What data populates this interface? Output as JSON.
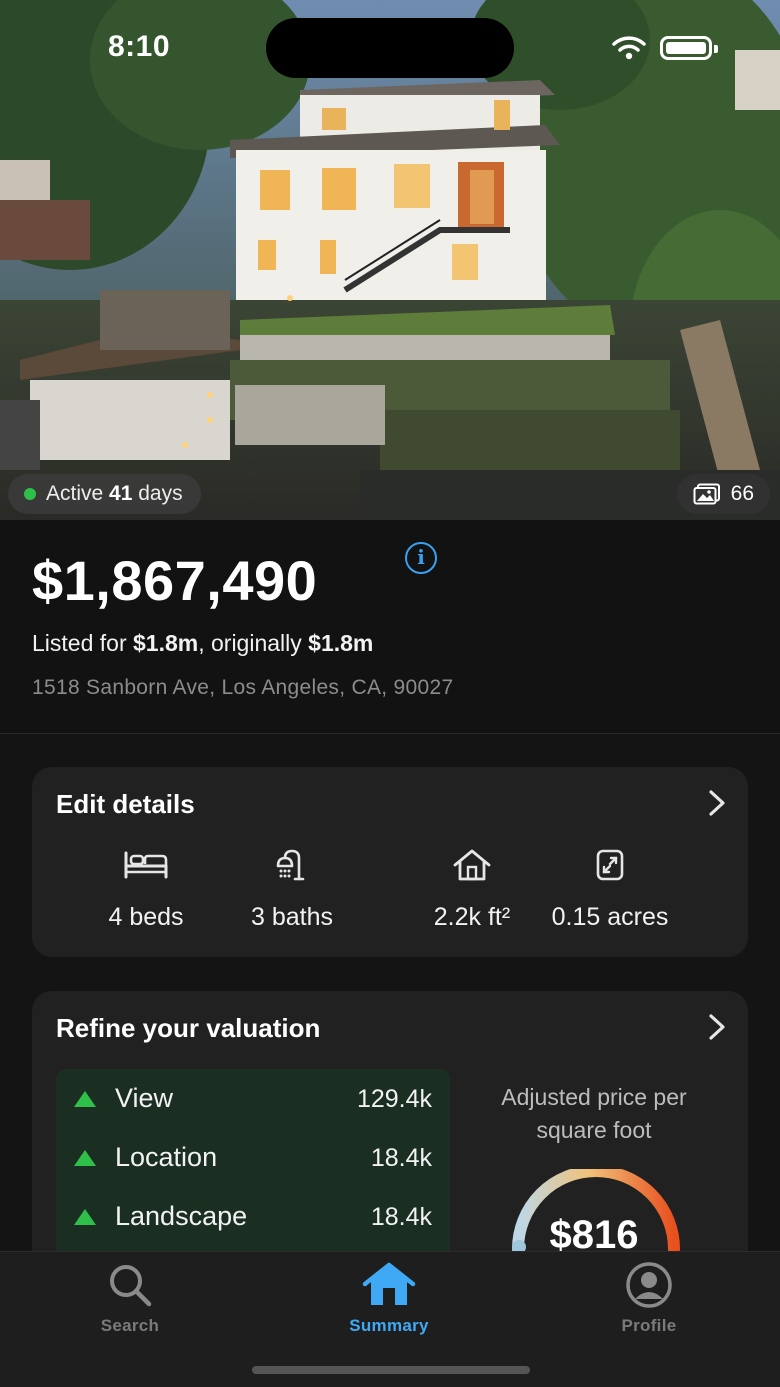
{
  "status_bar": {
    "time": "8:10"
  },
  "hero": {
    "active_prefix": "Active",
    "active_days": "41",
    "active_suffix": "days",
    "photo_count": "66",
    "status_color": "#2fc04a"
  },
  "listing": {
    "price": "$1,867,490",
    "listed_prefix": "Listed for",
    "listed_price": "$1.8m",
    "original_prefix": ", originally",
    "original_price": "$1.8m",
    "address": "1518 Sanborn Ave, Los Angeles, CA, 90027"
  },
  "details": {
    "title": "Edit details",
    "facts": [
      {
        "icon": "bed-icon",
        "value": "4 beds"
      },
      {
        "icon": "shower-icon",
        "value": "3 baths"
      },
      {
        "icon": "house-icon",
        "value": "2.2k ft²"
      },
      {
        "icon": "lot-size-icon",
        "value": "0.15 acres"
      }
    ]
  },
  "valuation": {
    "title": "Refine your valuation",
    "adjustments": [
      {
        "name": "View",
        "amount": "129.4k",
        "direction": "up"
      },
      {
        "name": "Location",
        "amount": "18.4k",
        "direction": "up"
      },
      {
        "name": "Landscape",
        "amount": "18.4k",
        "direction": "up"
      }
    ],
    "ppsf_label": "Adjusted price per square foot",
    "ppsf_value": "$816",
    "positive_color": "#2fc04a"
  },
  "tabbar": {
    "tabs": [
      {
        "label": "Search",
        "icon": "search-icon",
        "active": false
      },
      {
        "label": "Summary",
        "icon": "home-icon",
        "active": true
      },
      {
        "label": "Profile",
        "icon": "profile-icon",
        "active": false
      }
    ],
    "accent_color": "#3fa9f5"
  }
}
